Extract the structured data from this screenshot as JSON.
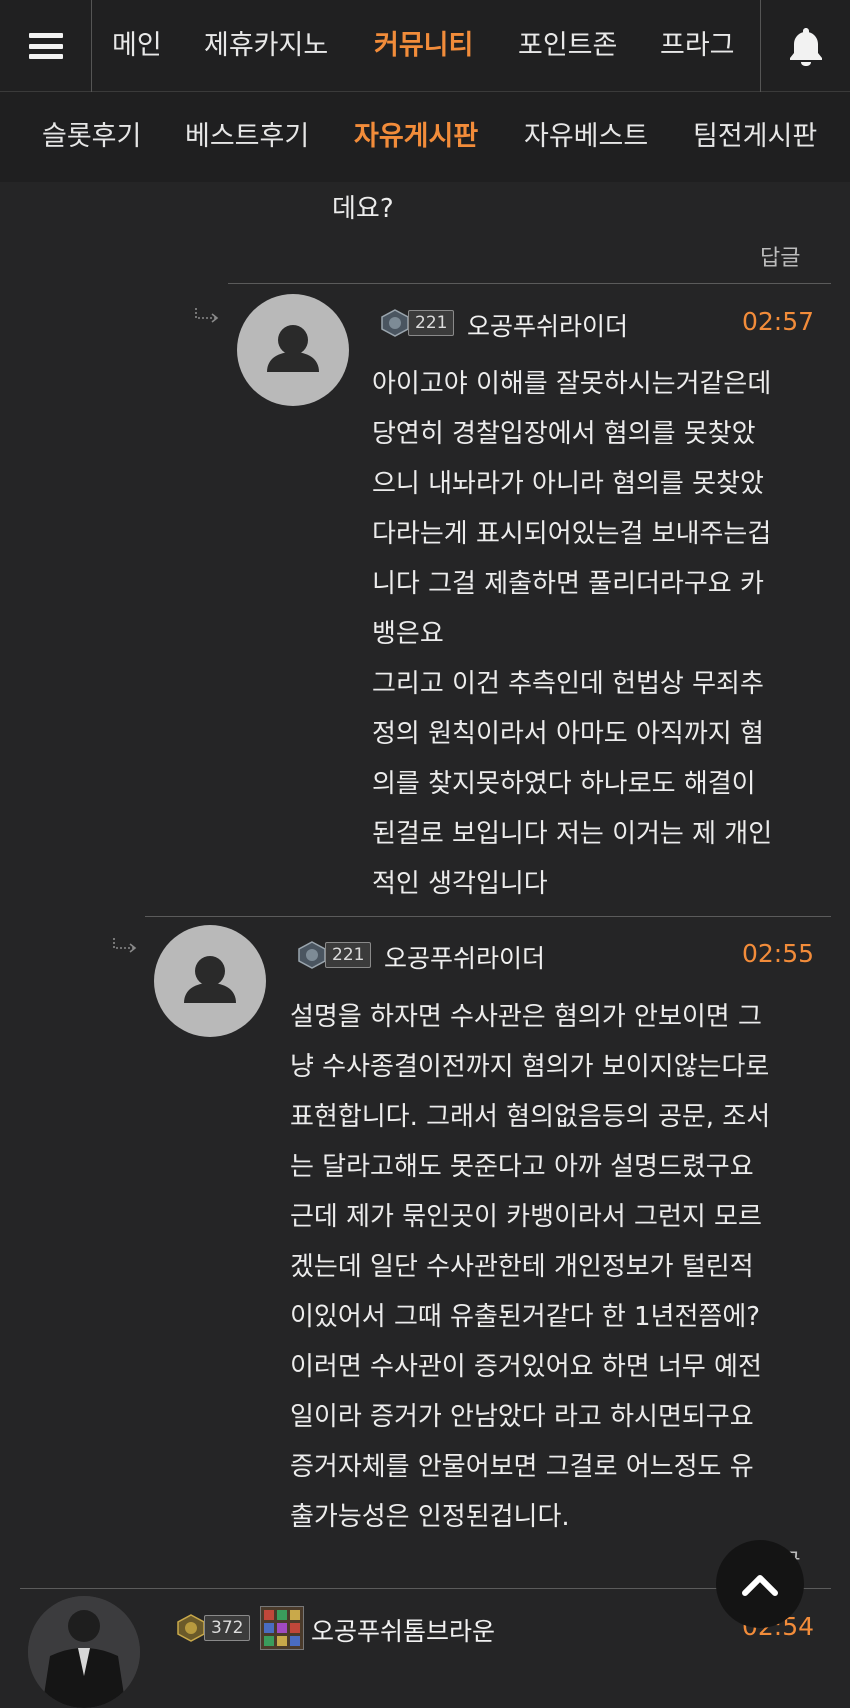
{
  "topnav": {
    "menu_icon": "hamburger-icon",
    "tabs": [
      {
        "label": "메인",
        "active": false
      },
      {
        "label": "제휴카지노",
        "active": false
      },
      {
        "label": "커뮤니티",
        "active": true
      },
      {
        "label": "포인트존",
        "active": false
      },
      {
        "label": "프라그",
        "active": false
      }
    ],
    "bell_icon": "bell-icon",
    "active_color": "#f28c3a"
  },
  "subnav": {
    "tabs": [
      {
        "label": "슬롯후기",
        "active": false
      },
      {
        "label": "베스트후기",
        "active": false
      },
      {
        "label": "자유게시판",
        "active": true
      },
      {
        "label": "자유베스트",
        "active": false
      },
      {
        "label": "팀전게시판",
        "active": false
      }
    ]
  },
  "comments": [
    {
      "partial": true,
      "lines": [
        "데요?"
      ],
      "reply_label": "답글"
    },
    {
      "level": "221",
      "author": "오공푸쉬라이더",
      "time": "02:57",
      "lines": [
        "아이고야 이해를 잘못하시는거같은데",
        "당연히 경찰입장에서 혐의를 못찾았",
        "으니 내놔라가 아니라 혐의를 못찾았",
        "다라는게 표시되어있는걸 보내주는겁",
        "니다 그걸 제출하면 풀리더라구요 카",
        "뱅은요",
        "그리고 이건 추측인데 헌법상 무죄추",
        "정의 원칙이라서 아마도 아직까지 혐",
        "의를 찾지못하였다 하나로도 해결이",
        "된걸로 보입니다 저는 이거는 제 개인",
        "적인 생각입니다"
      ]
    },
    {
      "level": "221",
      "author": "오공푸쉬라이더",
      "time": "02:55",
      "lines": [
        "설명을 하자면 수사관은 혐의가 안보이면 그",
        "냥 수사종결이전까지 혐의가 보이지않는다로",
        "표현합니다. 그래서 혐의없음등의 공문, 조서",
        "는 달라고해도 못준다고 아까 설명드렸구요",
        "근데 제가 묶인곳이 카뱅이라서 그런지 모르",
        "겠는데 일단 수사관한테 개인정보가 털린적",
        "이있어서 그때 유출된거같다 한 1년전쯤에?",
        "이러면 수사관이 증거있어요 하면 너무 예전",
        "일이라 증거가 안남았다 라고 하시면되구요",
        "증거자체를 안물어보면 그걸로 어느정도 유",
        "출가능성은 인정된겁니다."
      ],
      "reply_label": "답글"
    },
    {
      "level": "372",
      "author": "오공푸쉬톰브라운",
      "time": "02:54"
    }
  ],
  "scroll_top_icon": "chevron-up-icon"
}
